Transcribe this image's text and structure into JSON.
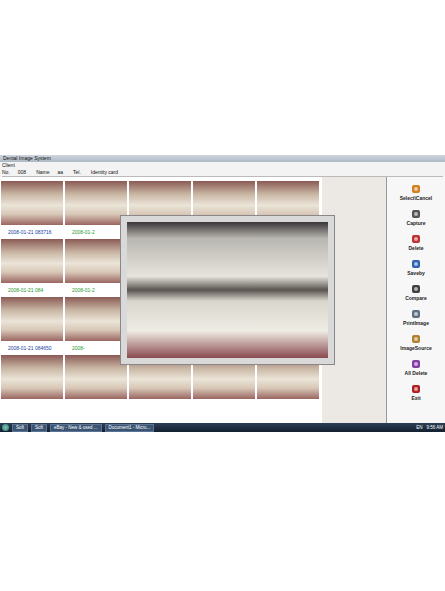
{
  "window": {
    "title": "Dental Image System"
  },
  "client": {
    "label": "Client",
    "fields": [
      {
        "label": "No.",
        "value": "008"
      },
      {
        "label": "Name",
        "value": "aa"
      },
      {
        "label": "Tel."
      },
      {
        "label": "Identity card"
      }
    ]
  },
  "gallery": {
    "rows": [
      {
        "labels": [
          {
            "text": "2008-01-21 083716",
            "color": "#2040a0"
          },
          {
            "text": "2008-01-2",
            "color": "#2a9a2a"
          }
        ]
      },
      {
        "labels": [
          {
            "text": "2008-01-21 084",
            "color": "#2a9a2a"
          },
          {
            "text": "2008-01-2",
            "color": "#2a9a2a"
          }
        ]
      },
      {
        "labels": [
          {
            "text": "2008-01-21 084650",
            "color": "#2040a0"
          },
          {
            "text": "2008-",
            "color": "#2a9a2a"
          }
        ]
      },
      {
        "labels": []
      }
    ]
  },
  "toolbar": [
    {
      "label": "Select\\Cancel",
      "color": "#d08020"
    },
    {
      "label": "Capture",
      "color": "#555555"
    },
    {
      "label": "Delete",
      "color": "#c03030"
    },
    {
      "label": "Saveby",
      "color": "#3060b0"
    },
    {
      "label": "Compare",
      "color": "#404040"
    },
    {
      "label": "PrintImage",
      "color": "#607080"
    },
    {
      "label": "ImageSource",
      "color": "#b08030"
    },
    {
      "label": "All Delete",
      "color": "#8040a0"
    },
    {
      "label": "Exit",
      "color": "#b02020"
    }
  ],
  "taskbar": {
    "items": [
      "Soft",
      "Soft",
      "eBay - New & used ...",
      "Document1 - Micro..."
    ],
    "language": "EN",
    "clock": "9:56 AM"
  }
}
